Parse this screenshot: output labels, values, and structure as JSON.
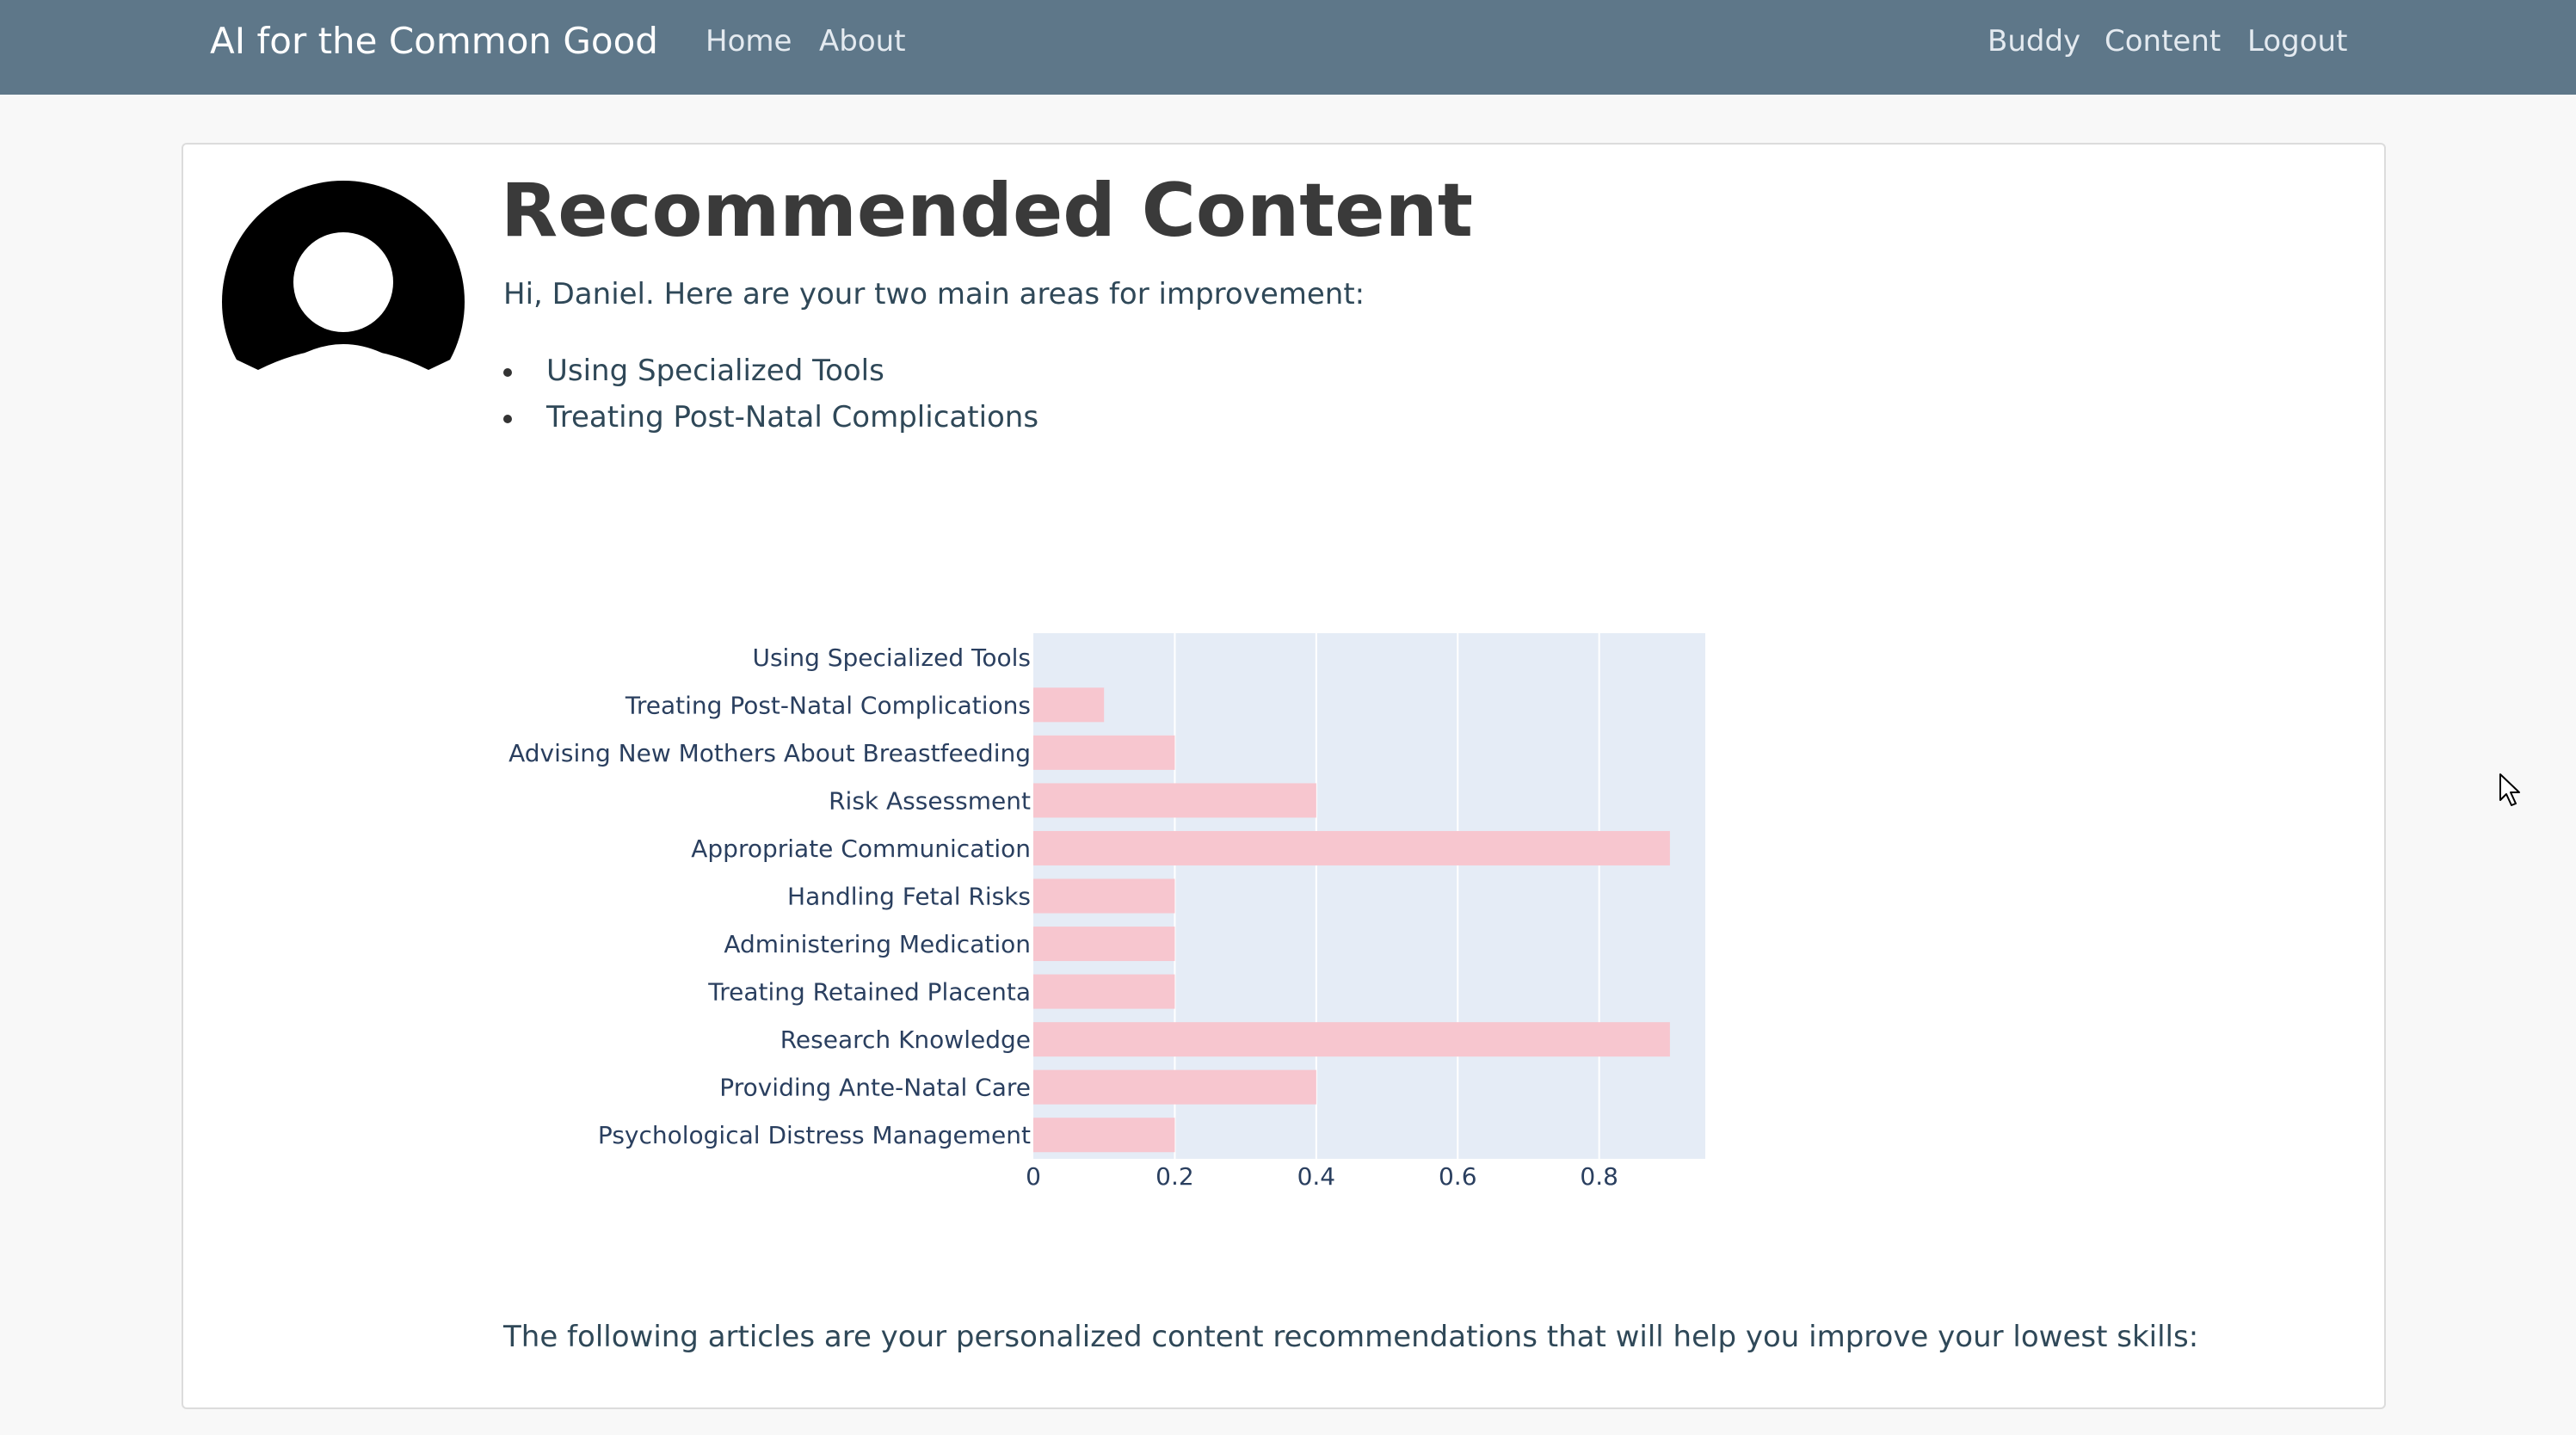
{
  "navbar": {
    "brand": "AI for the Common Good",
    "left_links": [
      "Home",
      "About"
    ],
    "right_links": [
      "Buddy",
      "Content",
      "Logout"
    ],
    "background": "#5e7789"
  },
  "main": {
    "title": "Recommended Content",
    "intro": "Hi, Daniel. Here are your two main areas for improvement:",
    "areas": [
      "Using Specialized Tools",
      "Treating Post-Natal Complications"
    ],
    "footer": "The following articles are your personalized content recommendations that will help you improve your lowest skills:"
  },
  "icons": {
    "avatar": "user-avatar-icon",
    "cursor": "mouse-pointer-icon"
  },
  "chart_data": {
    "type": "bar",
    "orientation": "horizontal",
    "categories": [
      "Using Specialized Tools",
      "Treating Post-Natal Complications",
      "Advising New Mothers About Breastfeeding",
      "Risk Assessment",
      "Appropriate Communication",
      "Handling Fetal Risks",
      "Administering Medication",
      "Treating Retained Placenta",
      "Research Knowledge",
      "Providing Ante-Natal Care",
      "Psychological Distress Management"
    ],
    "values": [
      0,
      0.1,
      0.2,
      0.4,
      0.9,
      0.2,
      0.2,
      0.2,
      0.9,
      0.4,
      0.2
    ],
    "xticks": [
      "0",
      "0.2",
      "0.4",
      "0.6",
      "0.8"
    ],
    "xlim": [
      0,
      0.95
    ],
    "grid": true,
    "bar_color": "#f7c6cf",
    "plot_background": "#e5ecf6"
  }
}
